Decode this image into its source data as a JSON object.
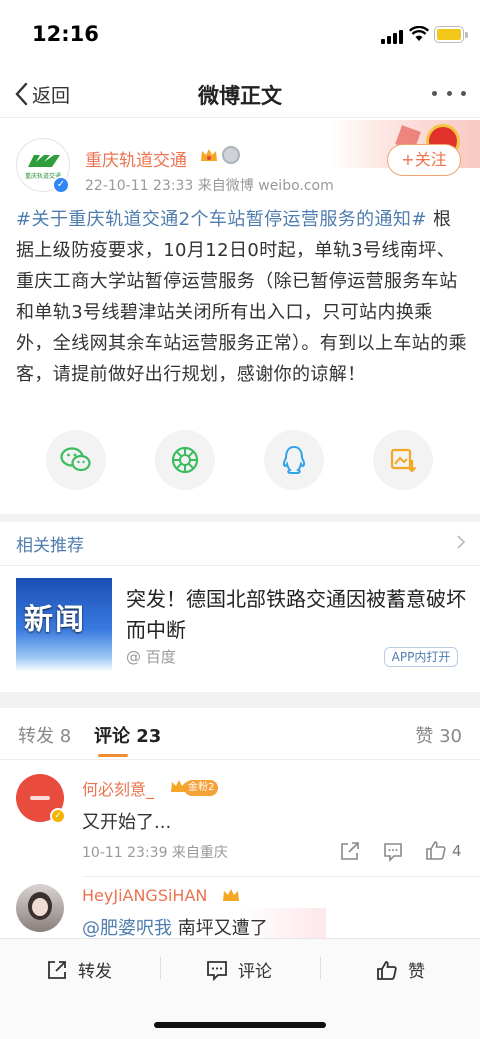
{
  "status_bar": {
    "time": "12:16"
  },
  "nav": {
    "back_label": "返回",
    "title": "微博正文"
  },
  "post": {
    "author": "重庆轨道交通",
    "avatar_text": "重庆轨道交通",
    "meta": "22-10-11 23:33  来自微博 weibo.com",
    "follow_label": "+关注",
    "hashtag": "#关于重庆轨道交通2个车站暂停运营服务的通知#",
    "text": " 根据上级防疫要求，10月12日0时起，单轨3号线南坪、重庆工商大学站暂停运营服务（除已暂停运营服务车站和单轨3号线碧津站关闭所有出入口，只可站内换乘外，全线网其余车站运营服务正常）。有到以上车站的乘客，请提前做好出行规划，感谢你的谅解！"
  },
  "share_icons": [
    "wechat-icon",
    "moments-icon",
    "qq-icon",
    "save-image-icon"
  ],
  "related": {
    "header": "相关推荐",
    "item": {
      "image_text": "新闻",
      "title": "突发！德国北部铁路交通因被蓄意破坏而中断",
      "source": "@ 百度",
      "app_label": "APP内打开"
    }
  },
  "tabs": {
    "repost": "转发 8",
    "comments": "评论 23",
    "likes": "赞 30"
  },
  "comments": [
    {
      "name": "何必刻意_",
      "badge": "金粉2",
      "text": "又开始了...",
      "meta": "10-11 23:39  来自重庆",
      "likes": "4"
    },
    {
      "name": "HeyJiANGSiHAN",
      "mention": "@肥婆呎我",
      "text": " 南坪又遭了"
    }
  ],
  "bottom_bar": {
    "repost": "转发",
    "comment": "评论",
    "like": "赞"
  },
  "colors": {
    "accent": "#eb7350",
    "link": "#507daf",
    "verified": "#2f86f6"
  }
}
